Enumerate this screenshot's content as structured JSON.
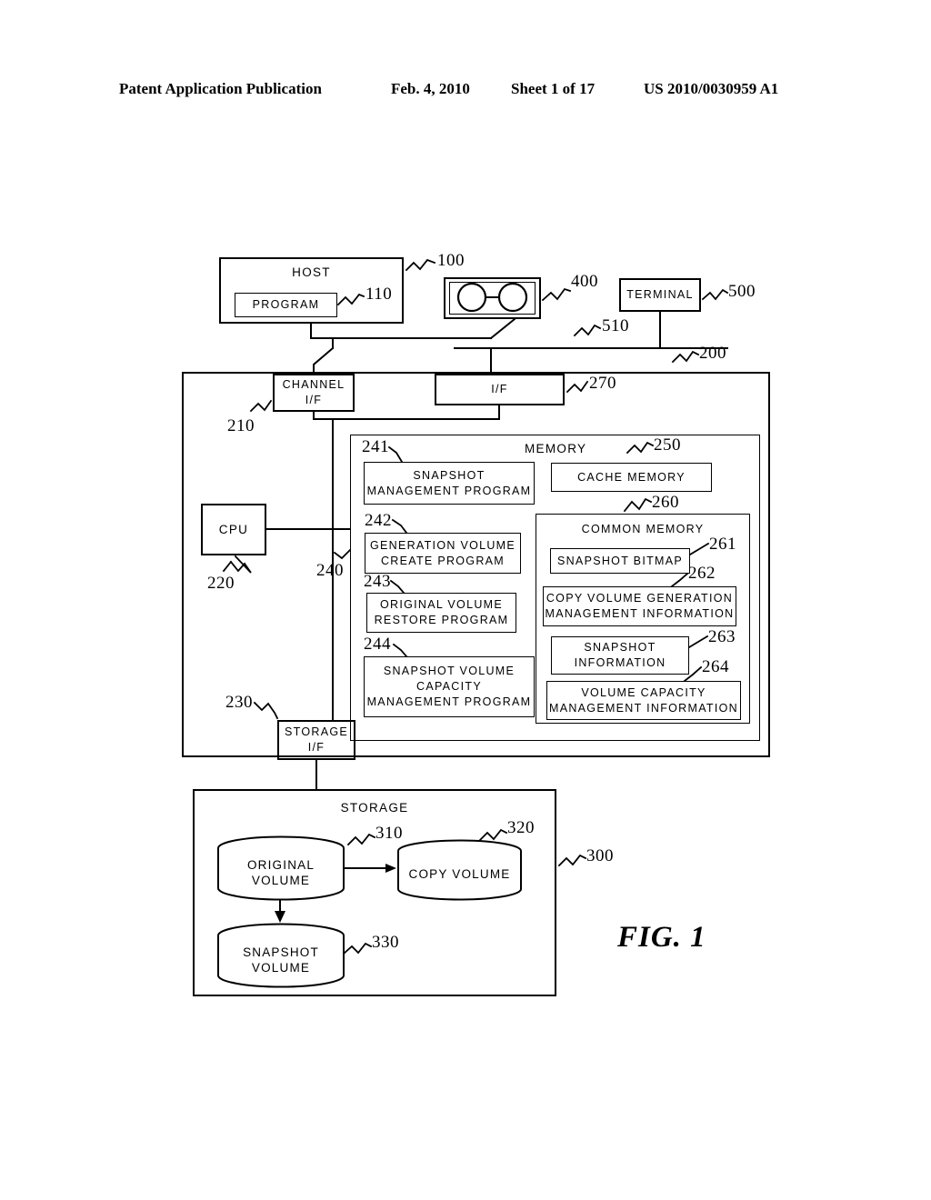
{
  "header": {
    "publication": "Patent Application Publication",
    "date": "Feb. 4, 2010",
    "sheet": "Sheet 1 of 17",
    "number": "US 2010/0030959 A1"
  },
  "figure": {
    "label": "FIG. 1"
  },
  "nodes": {
    "host": {
      "title": "HOST",
      "ref": "100"
    },
    "host_program": {
      "title": "PROGRAM",
      "ref": "110"
    },
    "switch": {
      "ref": "400"
    },
    "terminal": {
      "title": "TERMINAL",
      "ref": "500"
    },
    "network": {
      "ref": "510"
    },
    "controller": {
      "ref": "200"
    },
    "channel_if": {
      "line1": "CHANNEL",
      "line2": "I/F",
      "ref": "210"
    },
    "cpu": {
      "title": "CPU",
      "ref": "220"
    },
    "storage_if": {
      "line1": "STORAGE",
      "line2": "I/F",
      "ref": "230"
    },
    "if": {
      "title": "I/F",
      "ref": "270"
    },
    "bus": {
      "ref": "240"
    },
    "memory": {
      "title": "MEMORY"
    },
    "cache_memory": {
      "title": "CACHE MEMORY",
      "ref": "250"
    },
    "common_memory": {
      "title": "COMMON MEMORY",
      "ref": "260"
    },
    "snapshot_management_program": {
      "line1": "SNAPSHOT",
      "line2": "MANAGEMENT PROGRAM",
      "ref": "241"
    },
    "generation_volume_create_program": {
      "line1": "GENERATION VOLUME",
      "line2": "CREATE PROGRAM",
      "ref": "242"
    },
    "original_volume_restore_program": {
      "line1": "ORIGINAL VOLUME",
      "line2": "RESTORE PROGRAM",
      "ref": "243"
    },
    "snapshot_volume_capacity_management_program": {
      "line1": "SNAPSHOT VOLUME",
      "line2": "CAPACITY",
      "line3": "MANAGEMENT PROGRAM",
      "ref": "244"
    },
    "snapshot_bitmap": {
      "title": "SNAPSHOT BITMAP",
      "ref": "261"
    },
    "copy_volume_generation_management_information": {
      "line1": "COPY VOLUME GENERATION",
      "line2": "MANAGEMENT INFORMATION",
      "ref": "262"
    },
    "snapshot_information": {
      "line1": "SNAPSHOT",
      "line2": "INFORMATION",
      "ref": "263"
    },
    "volume_capacity_management_information": {
      "line1": "VOLUME CAPACITY",
      "line2": "MANAGEMENT INFORMATION",
      "ref": "264"
    },
    "storage": {
      "title": "STORAGE",
      "ref": "300"
    },
    "original_volume": {
      "line1": "ORIGINAL",
      "line2": "VOLUME",
      "ref": "310"
    },
    "copy_volume": {
      "line1": "COPY VOLUME",
      "ref": "320"
    },
    "snapshot_volume": {
      "line1": "SNAPSHOT",
      "line2": "VOLUME",
      "ref": "330"
    }
  }
}
